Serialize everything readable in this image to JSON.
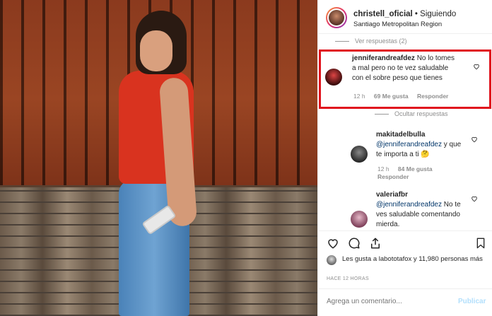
{
  "header": {
    "username": "christell_oficial",
    "separator": " • ",
    "follow_status": "Siguiendo",
    "location": "Santiago Metropolitan Region"
  },
  "comments": {
    "view_replies": "Ver respuestas (2)",
    "hide_replies": "Ocultar respuestas",
    "items": [
      {
        "user": "jenniferandreafdez",
        "text": "No lo tomes a mal pero no te vez saludable con el sobre peso que tienes",
        "time": "12 h",
        "likes": "69 Me gusta",
        "reply": "Responder"
      },
      {
        "user": "makitadelbulla",
        "mention": "@jenniferandreafdez",
        "text": "y que te importa a ti 🤔",
        "time": "12 h",
        "likes": "84 Me gusta",
        "reply": "Responder"
      },
      {
        "user": "valeriafbr",
        "mention": "@jenniferandreafdez",
        "text": "No te ves saludable comentando mierda."
      }
    ]
  },
  "likes": {
    "text": "Les gusta a labototafox y 11,980 personas más"
  },
  "timestamp": "HACE 12 HORAS",
  "add_comment": {
    "placeholder": "Agrega un comentario...",
    "button": "Publicar"
  },
  "icons": [
    "heart-icon",
    "comment-icon",
    "share-icon",
    "bookmark-icon"
  ],
  "colors": {
    "highlight": "#e0141e",
    "link": "#003569",
    "publish_disabled": "#b2dffc"
  }
}
